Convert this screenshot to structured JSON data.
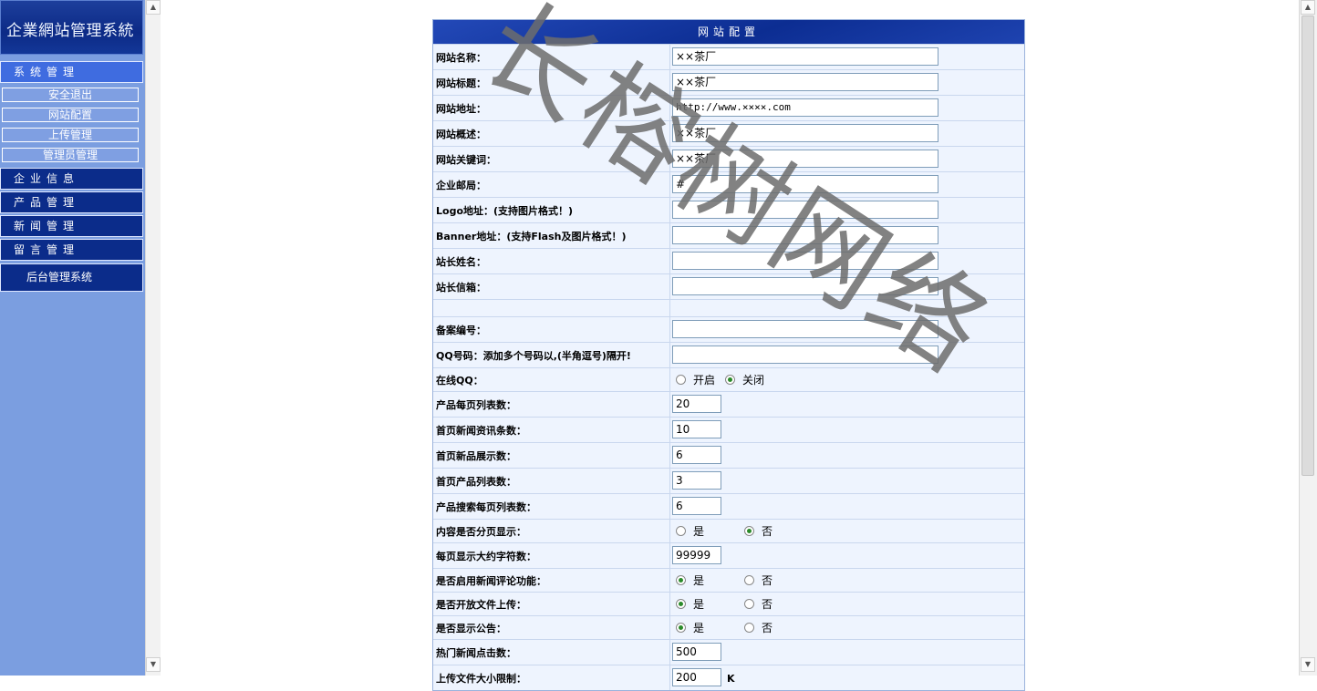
{
  "sidebar": {
    "logo": "企業網站管理系統",
    "menu": [
      {
        "label": "系统管理",
        "active": true,
        "items": [
          "安全退出",
          "网站配置",
          "上传管理",
          "管理员管理"
        ]
      },
      {
        "label": "企业信息"
      },
      {
        "label": "产品管理"
      },
      {
        "label": "新闻管理"
      },
      {
        "label": "留言管理"
      }
    ],
    "footer": "后台管理系统"
  },
  "config": {
    "title": "网站配置",
    "rows": {
      "site_name": {
        "label": "网站名称：",
        "value": "××茶厂"
      },
      "site_title": {
        "label": "网站标题：",
        "value": "××茶厂"
      },
      "site_url": {
        "label": "网站地址：",
        "value": "http://www.××××.com"
      },
      "site_desc": {
        "label": "网站概述：",
        "value": "××茶厂"
      },
      "site_kw": {
        "label": "网站关键词：",
        "value": "××茶厂"
      },
      "email": {
        "label": "企业邮局：",
        "value": "#"
      },
      "logo": {
        "label": "Logo地址：(支持图片格式！)",
        "value": ""
      },
      "banner": {
        "label": "Banner地址：(支持Flash及图片格式！)",
        "value": ""
      },
      "owner": {
        "label": "站长姓名：",
        "value": ""
      },
      "owner_mail": {
        "label": "站长信箱：",
        "value": ""
      },
      "icp": {
        "label": "备案编号：",
        "value": ""
      },
      "qq": {
        "label": "QQ号码：添加多个号码以,(半角逗号)隔开!",
        "value": ""
      },
      "online_qq": {
        "label": "在线QQ：",
        "opt1": "开启",
        "opt2": "关闭",
        "selected": "关闭"
      },
      "prod_per_page": {
        "label": "产品每页列表数：",
        "value": "20"
      },
      "home_news": {
        "label": "首页新闻资讯条数：",
        "value": "10"
      },
      "home_new_prod": {
        "label": "首页新品展示数：",
        "value": "6"
      },
      "home_prod_list": {
        "label": "首页产品列表数：",
        "value": "3"
      },
      "search_per_page": {
        "label": "产品搜索每页列表数：",
        "value": "6"
      },
      "paging": {
        "label": "内容是否分页显示：",
        "opt1": "是",
        "opt2": "否",
        "selected": "否"
      },
      "chars_per_page": {
        "label": "每页显示大约字符数：",
        "value": "99999"
      },
      "news_comment": {
        "label": "是否启用新闻评论功能：",
        "opt1": "是",
        "opt2": "否",
        "selected": "是"
      },
      "upload": {
        "label": "是否开放文件上传：",
        "opt1": "是",
        "opt2": "否",
        "selected": "是"
      },
      "notice": {
        "label": "是否显示公告：",
        "opt1": "是",
        "opt2": "否",
        "selected": "是"
      },
      "hot_clicks": {
        "label": "热门新闻点击数：",
        "value": "500"
      },
      "upload_limit": {
        "label": "上传文件大小限制：",
        "value": "200",
        "unit": "K"
      }
    }
  },
  "watermark": "长榕树网络",
  "colors": {
    "sidebar_bg": "#7b9ee0",
    "menu_dark": "#0b2c8a",
    "menu_active": "#3f6ce0",
    "table_bg": "#eef4fe",
    "title_bar": "#0c2d92",
    "radio_on": "#2a8a2a"
  }
}
